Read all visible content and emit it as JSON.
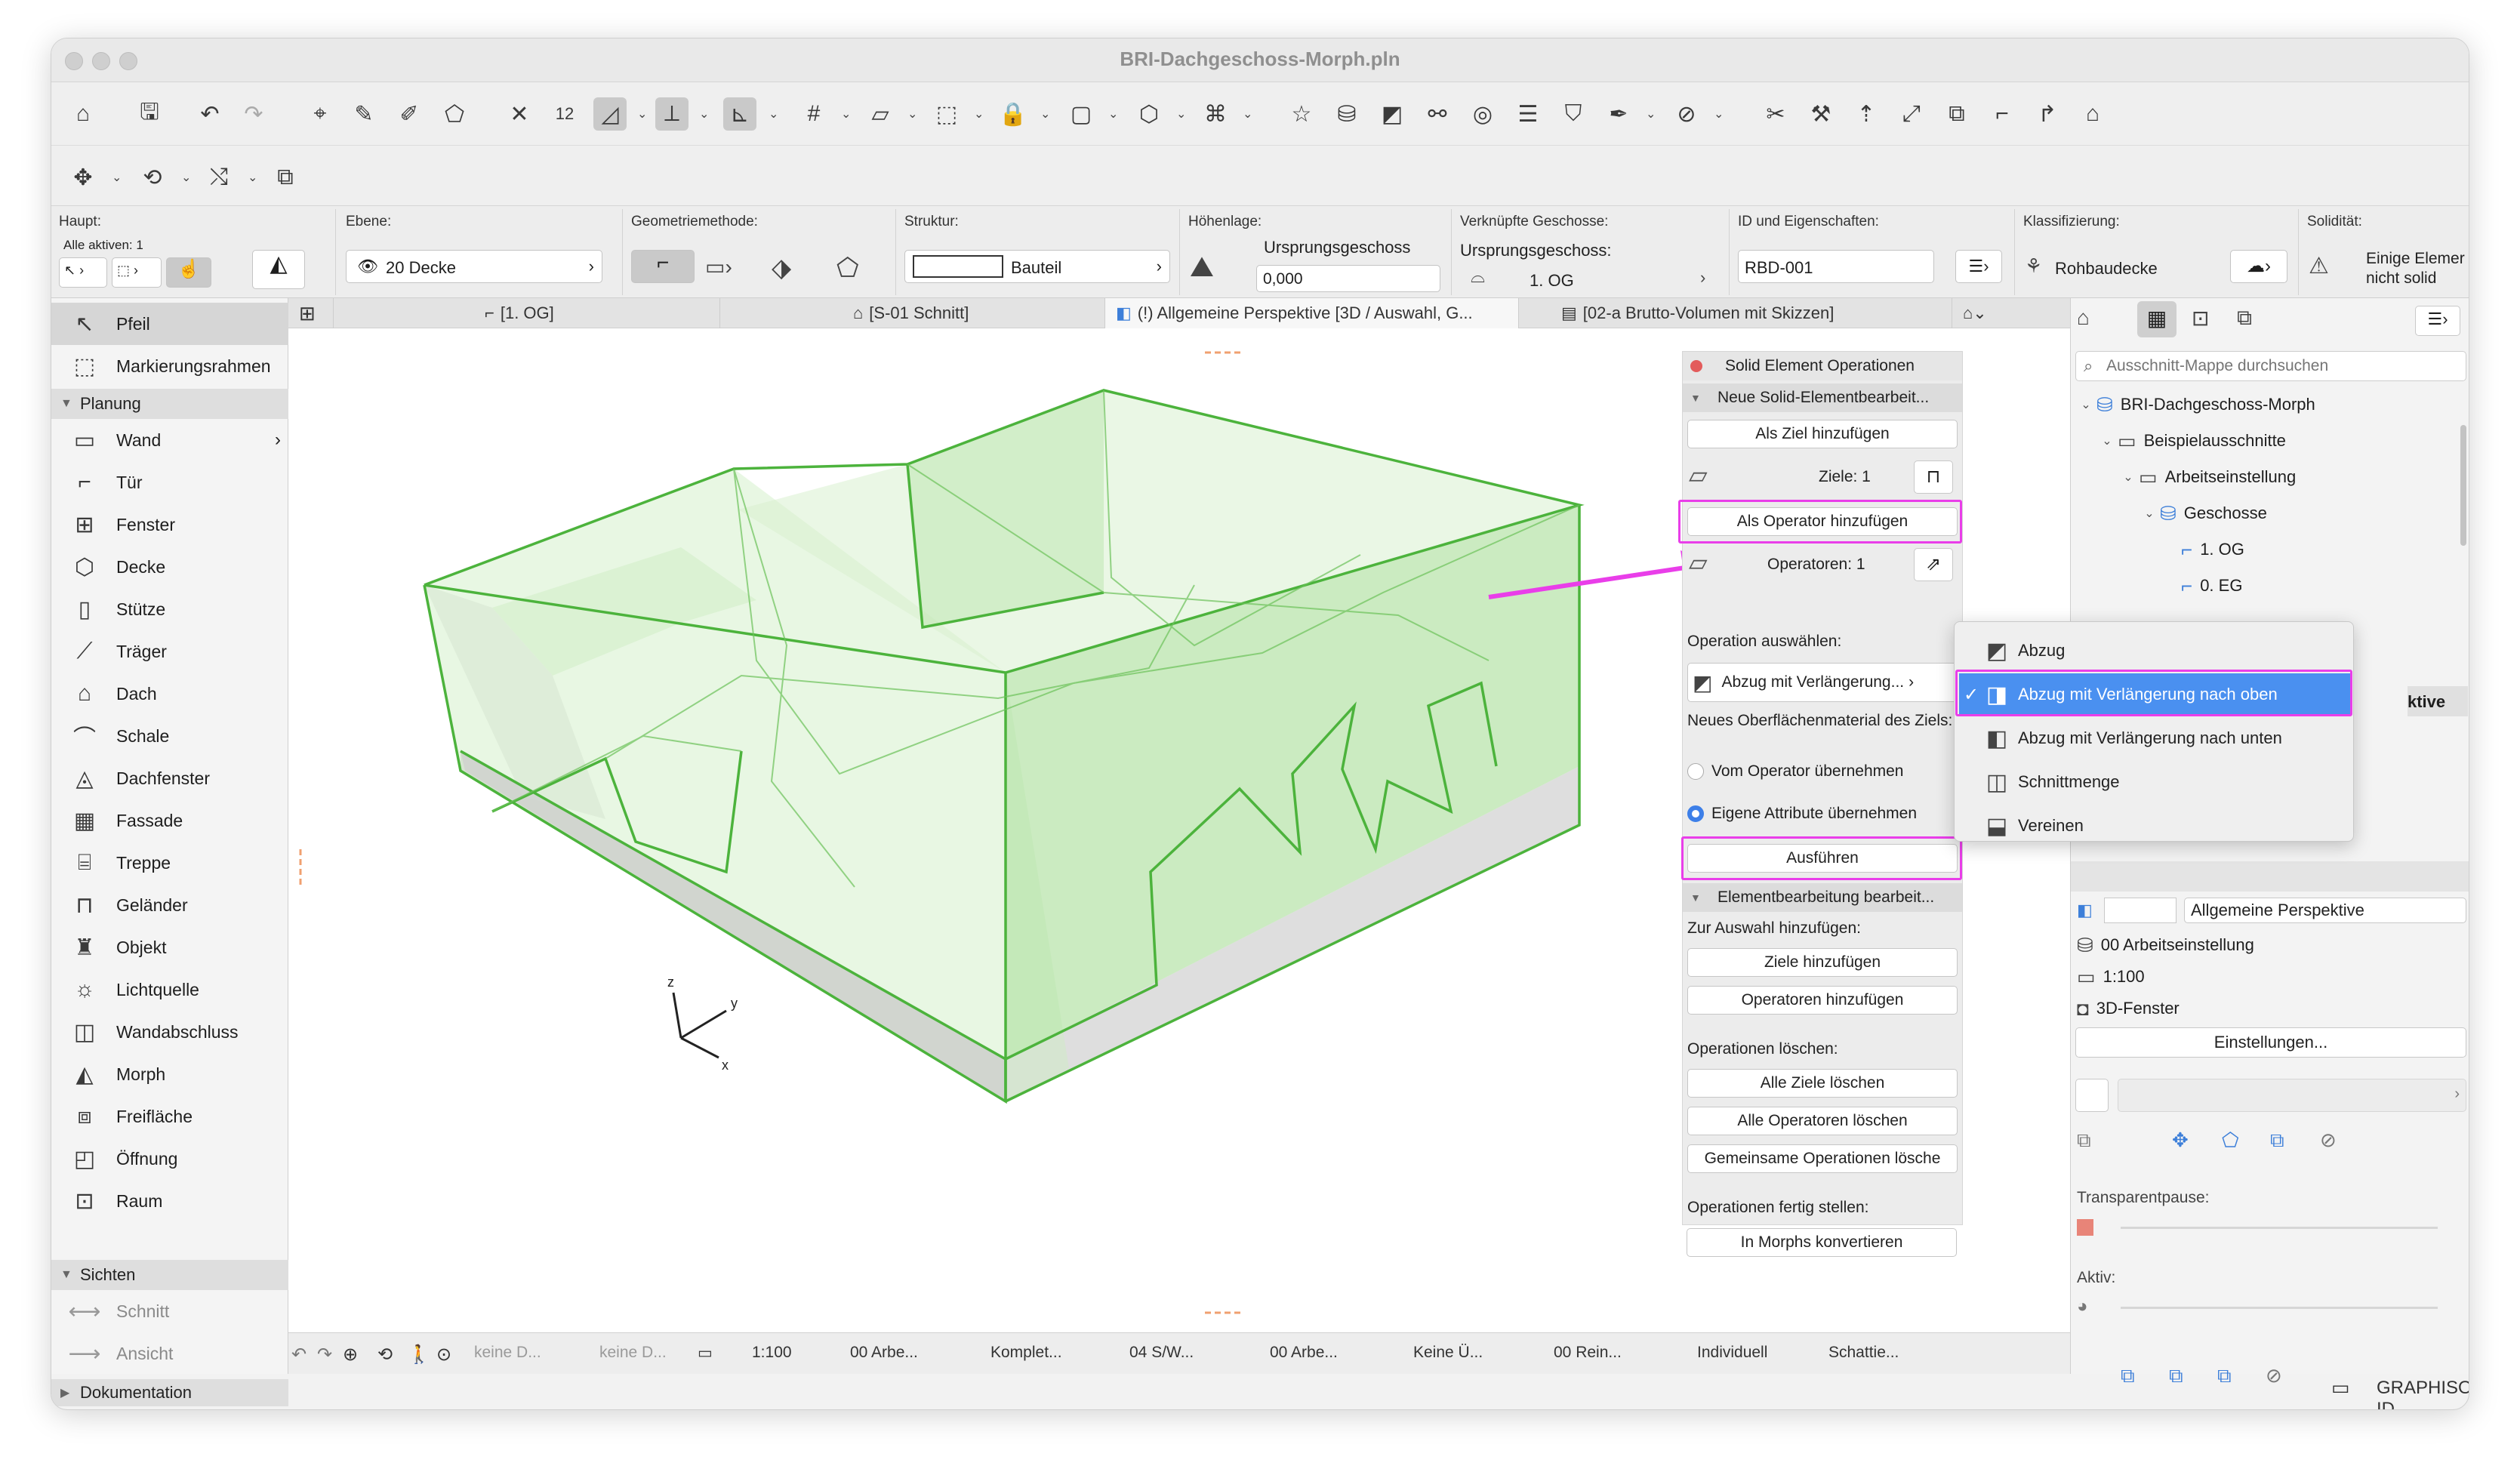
{
  "window": {
    "title": "BRI-Dachgeschoss-Morph.pln"
  },
  "infobox": {
    "haupt_label": "Haupt:",
    "alle_aktiven": "Alle aktiven: 1",
    "ebene_label": "Ebene:",
    "ebene_value": "20 Decke",
    "geometrie_label": "Geometriemethode:",
    "struktur_label": "Struktur:",
    "struktur_value": "Bauteil",
    "hoehenlage_label": "Höhenlage:",
    "hoehenlage_ref": "Ursprungsgeschoss",
    "hoehenlage_value": "0,000",
    "verknuepfte_label": "Verknüpfte Geschosse:",
    "ursprung_label": "Ursprungsgeschoss:",
    "ursprung_value": "1. OG",
    "id_label": "ID und Eigenschaften:",
    "id_value": "RBD-001",
    "klass_label": "Klassifizierung:",
    "klass_value": "Rohbaudecke",
    "solid_label": "Solidität:",
    "solid_value_1": "Einige Elemer",
    "solid_value_2": "nicht solid"
  },
  "toolbox": {
    "items": [
      {
        "label": "Pfeil",
        "icon": "arrow-icon"
      },
      {
        "label": "Markierungsrahmen",
        "icon": "marquee-icon"
      }
    ],
    "section_planung": "Planung",
    "planung": [
      {
        "label": "Wand",
        "icon": "wall-icon"
      },
      {
        "label": "Tür",
        "icon": "door-icon"
      },
      {
        "label": "Fenster",
        "icon": "window-icon"
      },
      {
        "label": "Decke",
        "icon": "slab-icon"
      },
      {
        "label": "Stütze",
        "icon": "column-icon"
      },
      {
        "label": "Träger",
        "icon": "beam-icon"
      },
      {
        "label": "Dach",
        "icon": "roof-icon"
      },
      {
        "label": "Schale",
        "icon": "shell-icon"
      },
      {
        "label": "Dachfenster",
        "icon": "skylight-icon"
      },
      {
        "label": "Fassade",
        "icon": "curtain-wall-icon"
      },
      {
        "label": "Treppe",
        "icon": "stair-icon"
      },
      {
        "label": "Geländer",
        "icon": "railing-icon"
      },
      {
        "label": "Objekt",
        "icon": "object-icon"
      },
      {
        "label": "Lichtquelle",
        "icon": "lamp-icon"
      },
      {
        "label": "Wandabschluss",
        "icon": "wall-end-icon"
      },
      {
        "label": "Morph",
        "icon": "morph-icon"
      },
      {
        "label": "Freifläche",
        "icon": "mesh-icon"
      },
      {
        "label": "Öffnung",
        "icon": "opening-icon"
      },
      {
        "label": "Raum",
        "icon": "zone-icon"
      }
    ],
    "section_sichten": "Sichten",
    "sichten": [
      {
        "label": "Schnitt"
      },
      {
        "label": "Ansicht"
      }
    ],
    "section_dokumentation": "Dokumentation"
  },
  "tabs": [
    {
      "label": "[1. OG]"
    },
    {
      "label": "[S-01 Schnitt]"
    },
    {
      "label": "(!) Allgemeine Perspektive [3D / Auswahl, G..."
    },
    {
      "label": "[02-a Brutto-Volumen mit Skizzen]"
    }
  ],
  "seo": {
    "title": "Solid Element Operationen",
    "section_new": "Neue Solid-Elementbearbeit...",
    "add_target": "Als Ziel hinzufügen",
    "targets": "Ziele: 1",
    "add_operator": "Als Operator hinzufügen",
    "operators": "Operatoren: 1",
    "choose_op": "Operation auswählen:",
    "op_value": "Abzug mit Verlängerung...",
    "new_surface": "Neues Oberflächenmaterial des Ziels:",
    "radio_from_op": "Vom Operator übernehmen",
    "radio_own": "Eigene Attribute übernehmen",
    "execute": "Ausführen",
    "section_edit": "Elementbearbeitung bearbeit...",
    "add_to_sel": "Zur Auswahl hinzufügen:",
    "add_targets": "Ziele hinzufügen",
    "add_operators": "Operatoren hinzufügen",
    "delete_ops": "Operationen löschen:",
    "delete_targets": "Alle Ziele löschen",
    "delete_operators": "Alle Operatoren löschen",
    "delete_common": "Gemeinsame Operationen lösche",
    "finish": "Operationen fertig stellen:",
    "convert": "In Morphs konvertieren"
  },
  "menu": {
    "items": [
      {
        "label": "Abzug",
        "checked": false
      },
      {
        "label": "Abzug mit Verlängerung nach oben",
        "checked": true
      },
      {
        "label": "Abzug mit Verlängerung nach unten",
        "checked": false
      },
      {
        "label": "Schnittmenge",
        "checked": false
      },
      {
        "label": "Vereinen",
        "checked": false
      }
    ],
    "check": "✓"
  },
  "navigator": {
    "search_placeholder": "Ausschnitt-Mappe durchsuchen",
    "tree": [
      {
        "label": "BRI-Dachgeschoss-Morph",
        "level": 0
      },
      {
        "label": "Beispielausschnitte",
        "level": 1
      },
      {
        "label": "Arbeitseinstellung",
        "level": 2
      },
      {
        "label": "Geschosse",
        "level": 3
      },
      {
        "label": "1. OG",
        "level": 4
      },
      {
        "label": "0. EG",
        "level": 4
      }
    ],
    "partial_label": "ktive",
    "view_name": "Allgemeine Perspektive",
    "layer_combo": "00 Arbeitseinstellung",
    "scale": "1:100",
    "window_type": "3D-Fenster",
    "settings_button": "Einstellungen...",
    "transparent_label": "Transparentpause:",
    "active_label": "Aktiv:",
    "brand": "GRAPHISOFT ID"
  },
  "status": {
    "no_d1": "keine D...",
    "no_d2": "keine D...",
    "scale": "1:100",
    "layers": "00 Arbe...",
    "complete": "Komplet...",
    "pen": "04 S/W...",
    "model": "00 Arbe...",
    "override": "Keine Ü...",
    "renovation": "00 Rein...",
    "custom": "Individuell",
    "shadow": "Schattie..."
  },
  "model3d": {
    "axis_x": "x",
    "axis_y": "y",
    "axis_z": "z",
    "colors": {
      "edge": "#4cb33c",
      "fill": "#bfe8b3",
      "ground": "#d9d9d9",
      "arrow": "#e93ee9",
      "selection": "#4a90f0"
    }
  }
}
